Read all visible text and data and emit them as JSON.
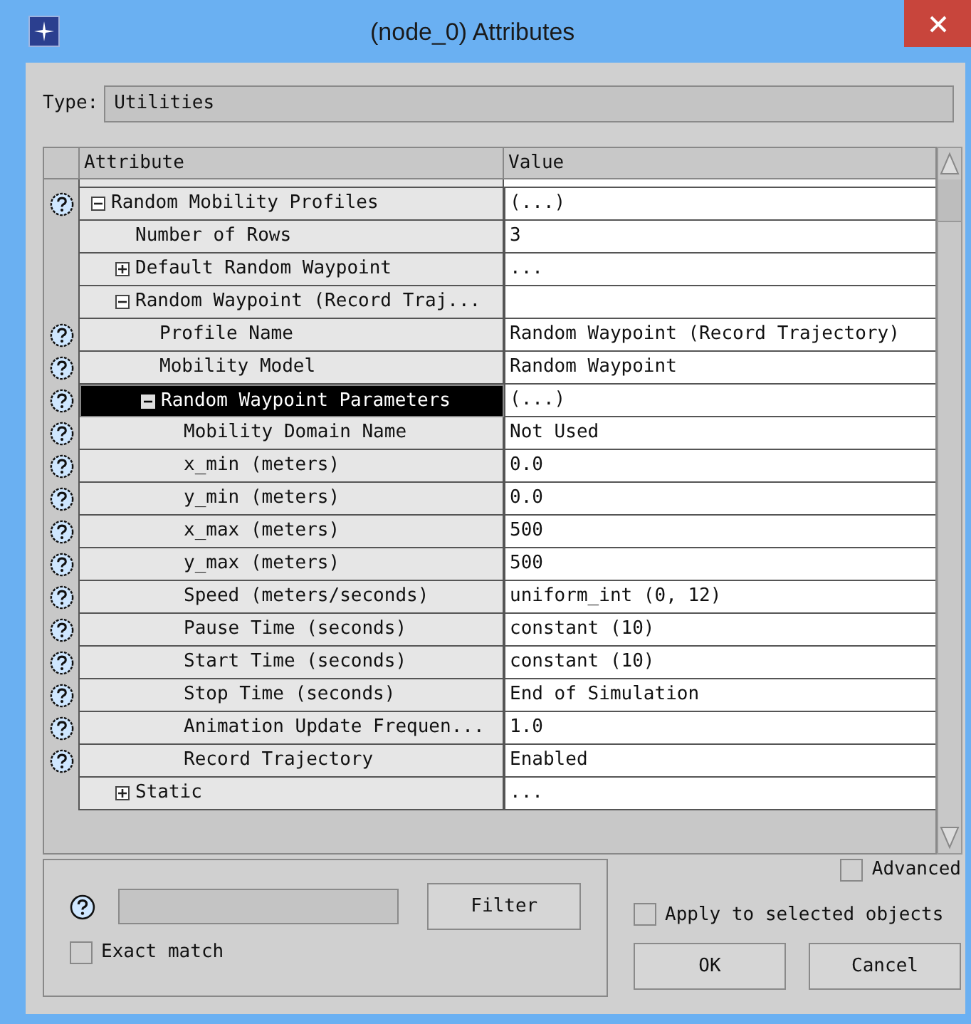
{
  "window": {
    "title": "(node_0) Attributes"
  },
  "type_field": {
    "label": "Type:",
    "value": "Utilities"
  },
  "table": {
    "columns": [
      "Attribute",
      "Value"
    ],
    "rows": [
      {
        "name": "Random Mobility Profiles",
        "value": "(...)",
        "help": true,
        "expanded": true,
        "selected": false,
        "children": [
          {
            "name": "Number of Rows",
            "value": "3",
            "help": false,
            "selected": false
          },
          {
            "name": "Default Random Waypoint",
            "value": "...",
            "help": false,
            "expanded": false,
            "selected": false
          },
          {
            "name": "Random Waypoint (Record Traj...",
            "help": false,
            "expanded": true,
            "selected": false,
            "children": [
              {
                "name": "Profile Name",
                "value": "Random Waypoint (Record Trajectory)",
                "help": true,
                "selected": false
              },
              {
                "name": "Mobility Model",
                "value": "Random Waypoint",
                "help": true,
                "selected": false
              },
              {
                "name": "Random Waypoint Parameters",
                "value": "(...)",
                "help": true,
                "expanded": true,
                "selected": true,
                "children": [
                  {
                    "name": "Mobility Domain Name",
                    "value": "Not Used",
                    "help": true,
                    "selected": false
                  },
                  {
                    "name": "x_min (meters)",
                    "value": "0.0",
                    "help": true,
                    "selected": false
                  },
                  {
                    "name": "y_min (meters)",
                    "value": "0.0",
                    "help": true,
                    "selected": false
                  },
                  {
                    "name": "x_max (meters)",
                    "value": "500",
                    "help": true,
                    "selected": false
                  },
                  {
                    "name": "y_max (meters)",
                    "value": "500",
                    "help": true,
                    "selected": false
                  },
                  {
                    "name": "Speed (meters/seconds)",
                    "value": "uniform_int (0, 12)",
                    "help": true,
                    "selected": false
                  },
                  {
                    "name": "Pause Time (seconds)",
                    "value": "constant (10)",
                    "help": true,
                    "selected": false
                  },
                  {
                    "name": "Start Time (seconds)",
                    "value": "constant (10)",
                    "help": true,
                    "selected": false
                  },
                  {
                    "name": "Stop Time (seconds)",
                    "value": "End of Simulation",
                    "help": true,
                    "selected": false
                  },
                  {
                    "name": "Animation Update Frequen...",
                    "value": "1.0",
                    "help": true,
                    "selected": false
                  },
                  {
                    "name": "Record Trajectory",
                    "value": "Enabled",
                    "help": true,
                    "selected": false
                  }
                ]
              }
            ]
          },
          {
            "name": "Static",
            "value": "...",
            "help": false,
            "expanded": false,
            "selected": false
          }
        ]
      }
    ]
  },
  "filter": {
    "button": {
      "label": "Filter"
    },
    "exact_match": {
      "label": "Exact match",
      "checked": false
    }
  },
  "advanced": {
    "label": "Advanced",
    "checked": false
  },
  "apply_to_selected": {
    "label": "Apply to selected objects",
    "checked": false
  },
  "buttons": [
    {
      "label": "OK"
    },
    {
      "label": "Cancel"
    }
  ]
}
